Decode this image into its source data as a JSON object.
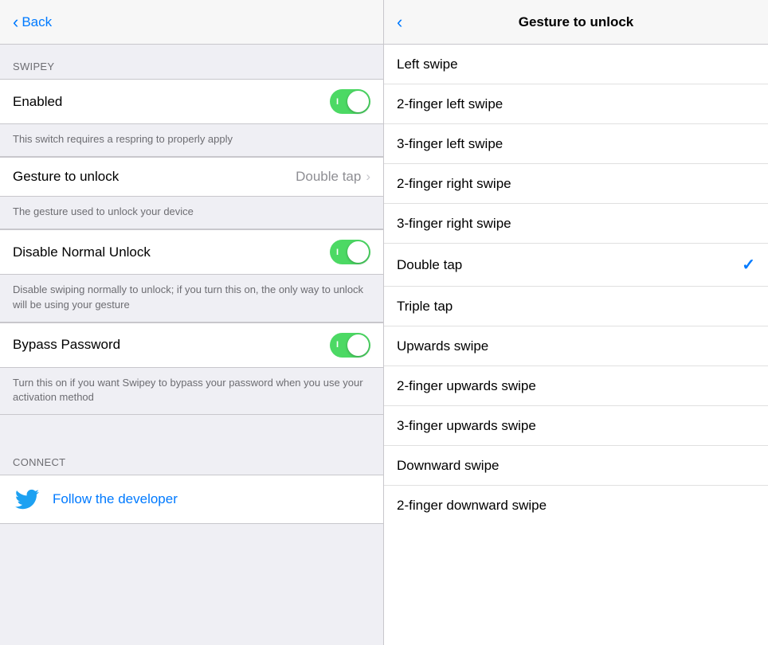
{
  "left": {
    "back_label": "Back",
    "section_swipey": "SWIPEY",
    "enabled_label": "Enabled",
    "enabled_on": true,
    "enabled_toggle_label": "I",
    "respring_note": "This switch requires a respring to properly apply",
    "gesture_label": "Gesture to unlock",
    "gesture_value": "Double tap",
    "gesture_note": "The gesture used to unlock your device",
    "disable_unlock_label": "Disable Normal Unlock",
    "disable_unlock_on": true,
    "disable_unlock_toggle_label": "I",
    "disable_unlock_note": "Disable swiping normally to unlock; if you turn this on, the only way to unlock will be using your gesture",
    "bypass_password_label": "Bypass Password",
    "bypass_password_on": true,
    "bypass_password_toggle_label": "I",
    "bypass_password_note": "Turn this on if you want Swipey to bypass your password when you use your activation method",
    "section_connect": "CONNECT",
    "follow_developer": "Follow the developer"
  },
  "right": {
    "title": "Gesture to unlock",
    "back_label": "",
    "gestures": [
      {
        "label": "Left swipe",
        "selected": false
      },
      {
        "label": "2-finger left swipe",
        "selected": false
      },
      {
        "label": "3-finger left swipe",
        "selected": false
      },
      {
        "label": "2-finger right swipe",
        "selected": false
      },
      {
        "label": "3-finger right swipe",
        "selected": false
      },
      {
        "label": "Double tap",
        "selected": true
      },
      {
        "label": "Triple tap",
        "selected": false
      },
      {
        "label": "Upwards swipe",
        "selected": false
      },
      {
        "label": "2-finger upwards swipe",
        "selected": false
      },
      {
        "label": "3-finger upwards swipe",
        "selected": false
      },
      {
        "label": "Downward swipe",
        "selected": false
      },
      {
        "label": "2-finger downward swipe",
        "selected": false
      }
    ]
  }
}
